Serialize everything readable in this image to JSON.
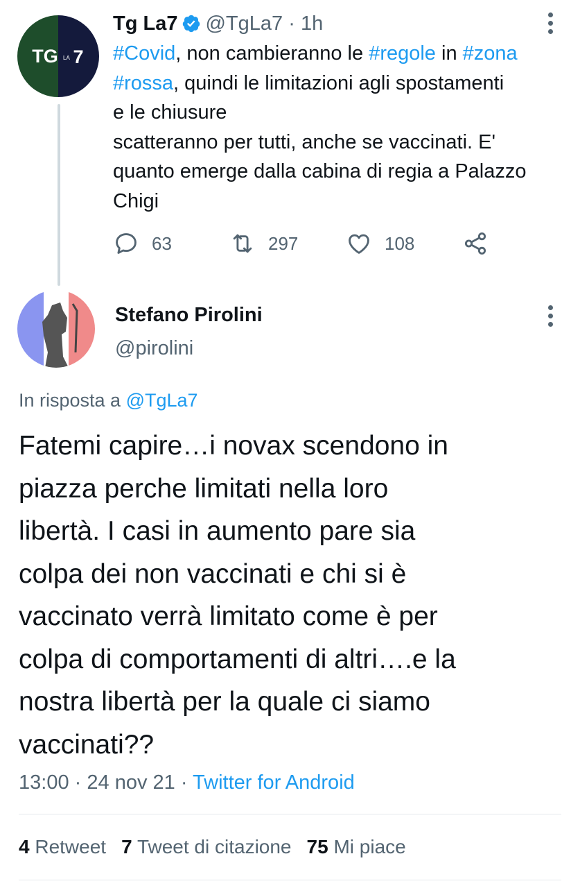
{
  "parent_tweet": {
    "display_name": "Tg La7",
    "handle": "@TgLa7",
    "separator": "·",
    "time_ago": "1h",
    "avatar_text": {
      "left": "TG",
      "right": "LA",
      "number": "7"
    },
    "text": {
      "tag_covid": "#Covid",
      "t1": ", non cambieranno le ",
      "tag_regole": "#regole",
      "t2": " in ",
      "tag_zona": "#zona",
      "tag_rossa": "#rossa",
      "t3": ", quindi le limitazioni agli spostamenti",
      "t4": "e le chiusure",
      "t5": "scatteranno per tutti, anche se vaccinati. E'",
      "t6": "quanto emerge dalla cabina di regia a Palazzo",
      "t7": "Chigi"
    },
    "actions": {
      "replies": "63",
      "retweets": "297",
      "likes": "108"
    }
  },
  "reply_tweet": {
    "display_name": "Stefano Pirolini",
    "handle": "@pirolini",
    "in_reply_to_label": "In risposta a ",
    "in_reply_to_handle": "@TgLa7",
    "text_lines": [
      "Fatemi capire…i novax scendono in",
      "piazza perche limitati nella loro",
      "libertà. I casi in aumento pare sia",
      "colpa dei non vaccinati e chi si è",
      "vaccinato verrà limitato come è per",
      "colpa di comportamenti di altri….e la",
      "nostra libertà per la quale ci siamo",
      "vaccinati??"
    ],
    "time": "13:00",
    "date": "24 nov 21",
    "separator": "·",
    "source": "Twitter for Android",
    "stats": {
      "retweets_count": "4",
      "retweets_label": "Retweet",
      "quotes_count": "7",
      "quotes_label": "Tweet di citazione",
      "likes_count": "75",
      "likes_label": "Mi piace"
    }
  },
  "colors": {
    "link": "#1d9bf0",
    "secondary": "#536471",
    "text": "#0f1419",
    "tg_green": "#1e4d2b",
    "tg_navy": "#141a3c"
  }
}
